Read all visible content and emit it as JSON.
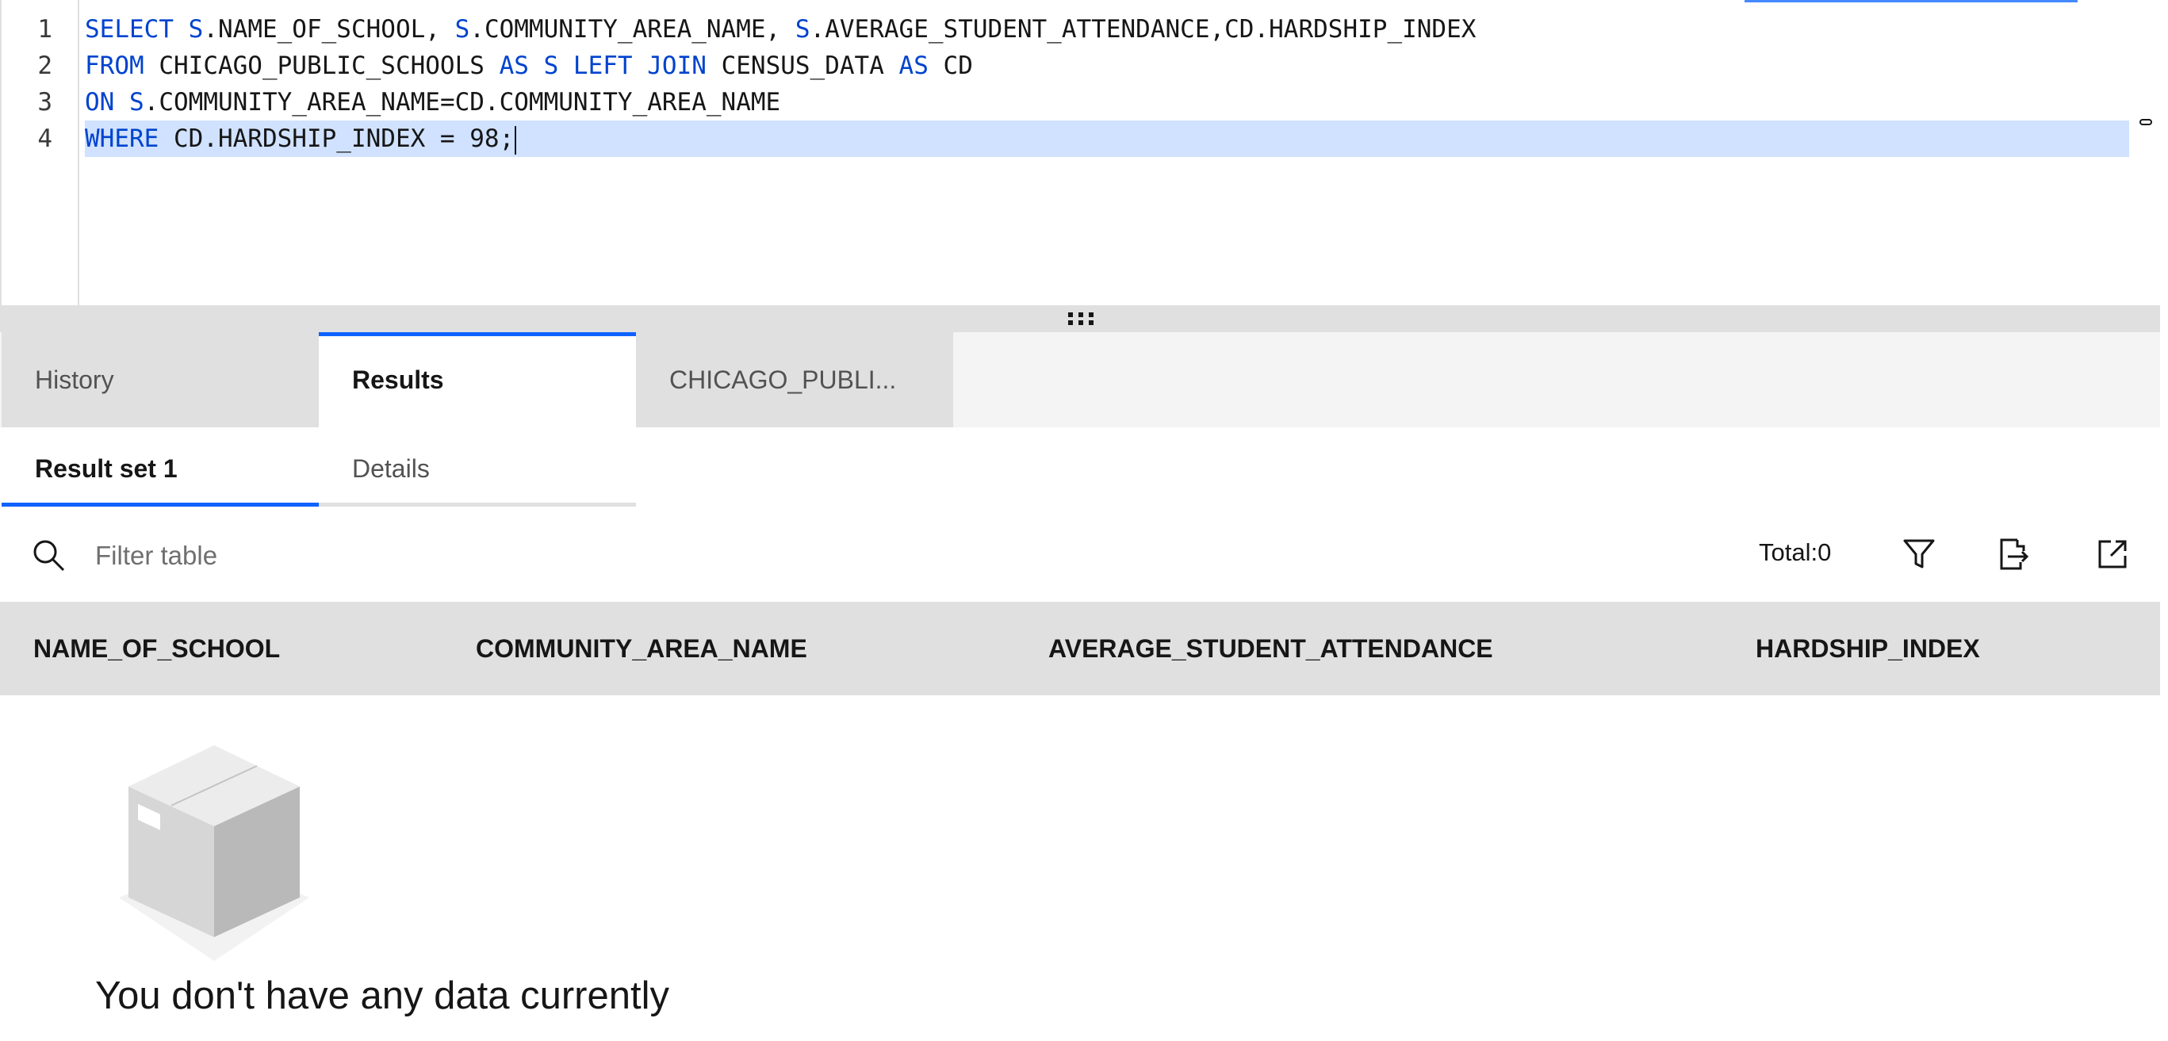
{
  "editor": {
    "line_numbers": [
      "1",
      "2",
      "3",
      "4"
    ],
    "lines": [
      [
        {
          "t": "SELECT ",
          "kw": true
        },
        {
          "t": "S",
          "kw": true
        },
        {
          "t": ".NAME_OF_SCHOOL, ",
          "kw": false
        },
        {
          "t": "S",
          "kw": true
        },
        {
          "t": ".COMMUNITY_AREA_NAME, ",
          "kw": false
        },
        {
          "t": "S",
          "kw": true
        },
        {
          "t": ".AVERAGE_STUDENT_ATTENDANCE,CD.HARDSHIP_INDEX",
          "kw": false
        }
      ],
      [
        {
          "t": "FROM ",
          "kw": true
        },
        {
          "t": "CHICAGO_PUBLIC_SCHOOLS ",
          "kw": false
        },
        {
          "t": "AS ",
          "kw": true
        },
        {
          "t": "S ",
          "kw": true
        },
        {
          "t": "LEFT ",
          "kw": true
        },
        {
          "t": "JOIN ",
          "kw": true
        },
        {
          "t": "CENSUS_DATA ",
          "kw": false
        },
        {
          "t": "AS ",
          "kw": true
        },
        {
          "t": "CD",
          "kw": false
        }
      ],
      [
        {
          "t": "ON ",
          "kw": true
        },
        {
          "t": "S",
          "kw": true
        },
        {
          "t": ".COMMUNITY_AREA_NAME=CD.COMMUNITY_AREA_NAME",
          "kw": false
        }
      ],
      [
        {
          "t": "WHERE ",
          "kw": true
        },
        {
          "t": "CD.HARDSHIP_INDEX = 98;",
          "kw": false
        }
      ]
    ],
    "active_line": 4
  },
  "tabs": [
    {
      "label": "History",
      "selected": false
    },
    {
      "label": "Results",
      "selected": true
    },
    {
      "label": "CHICAGO_PUBLI...",
      "selected": false
    }
  ],
  "subtabs": [
    {
      "label": "Result set 1",
      "selected": true
    },
    {
      "label": "Details",
      "selected": false
    }
  ],
  "toolbar": {
    "filter_placeholder": "Filter table",
    "total": "Total:0",
    "icons": [
      "filter-icon",
      "export-icon",
      "launch-icon"
    ]
  },
  "table": {
    "columns": [
      "NAME_OF_SCHOOL",
      "COMMUNITY_AREA_NAME",
      "AVERAGE_STUDENT_ATTENDANCE",
      "HARDSHIP_INDEX"
    ],
    "rows": []
  },
  "empty_state": {
    "message": "You don't have any data currently",
    "icon": "empty-box-illustration"
  },
  "colors": {
    "keyword": "#0043ce",
    "active_line": "#d0e2ff",
    "tab_accent": "#0f62fe"
  }
}
